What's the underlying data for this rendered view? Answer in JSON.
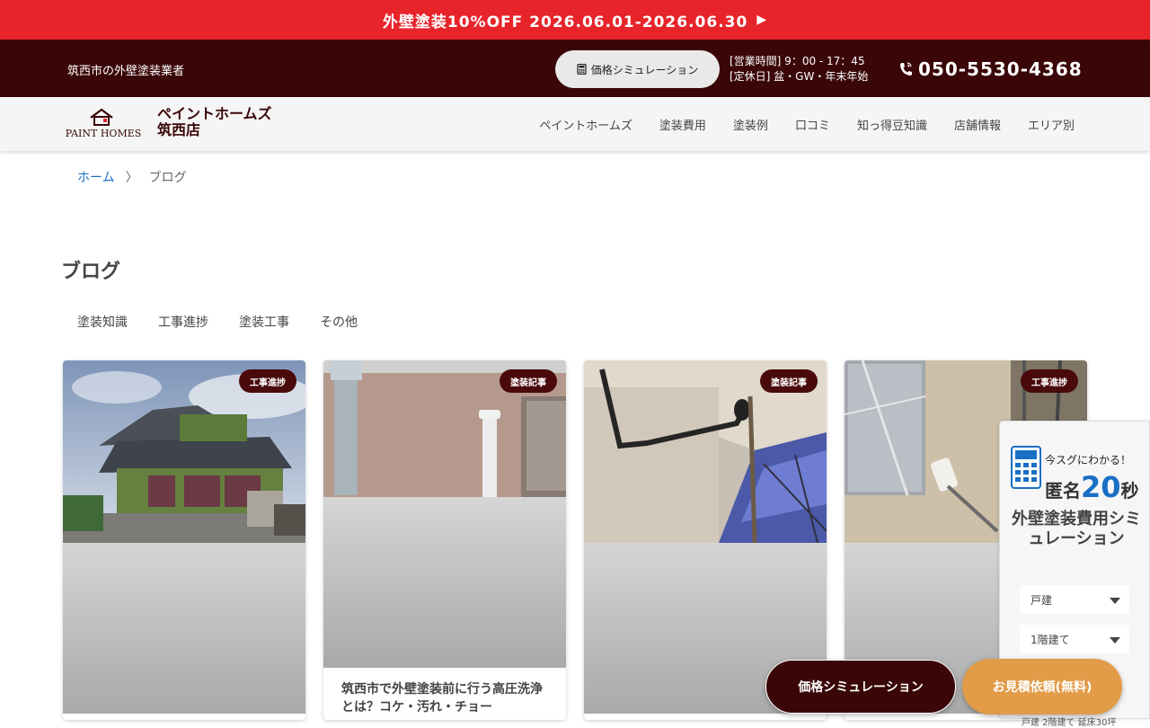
{
  "promo": {
    "text": "外壁塗装10%OFF 2026.06.01-2026.06.30",
    "arrow": "▶"
  },
  "topbar": {
    "tagline": "筑西市の外壁塗装業者",
    "sim_button": "価格シミュレーション",
    "hours_line1": "[営業時間] 9：00 - 17：45",
    "hours_line2": "[定休日] 盆・GW・年末年始",
    "phone": "050-5530-4368"
  },
  "header": {
    "logo_text": "PAINT HOMES",
    "brand_line1": "ペイントホームズ",
    "brand_line2": "筑西店",
    "nav": [
      "ペイントホームズ",
      "塗装費用",
      "塗装例",
      "口コミ",
      "知っ得豆知識",
      "店舗情報",
      "エリア別"
    ]
  },
  "breadcrumb": {
    "home": "ホーム",
    "sep": "〉",
    "current": "ブログ"
  },
  "page_title": "ブログ",
  "tabs": [
    "塗装知識",
    "工事進捗",
    "塗装工事",
    "その他"
  ],
  "cards": [
    {
      "badge": "工事進捗",
      "title": ""
    },
    {
      "badge": "塗装記事",
      "title": "筑西市で外壁塗装前に行う高圧洗浄とは？コケ・汚れ・チョー"
    },
    {
      "badge": "塗装記事",
      "title": ""
    },
    {
      "badge": "工事進捗",
      "title": ""
    }
  ],
  "widget": {
    "top": "今スグにわかる！",
    "anon_prefix": "匿名",
    "anon_num": "20",
    "anon_suffix": "秒",
    "title": "外壁塗装費用シミュレーション",
    "select1": "戸建",
    "select2": "1階建て",
    "bottom_text": "戸建 2階建て 延床30坪"
  },
  "floating": {
    "sim": "価格シミュレーション",
    "quote": "お見積依頼(無料)"
  },
  "colors": {
    "promo": "#e8242b",
    "dark": "#3a0607",
    "accent_blue": "#1a6fc4",
    "quote_orange": "#e29b47"
  }
}
